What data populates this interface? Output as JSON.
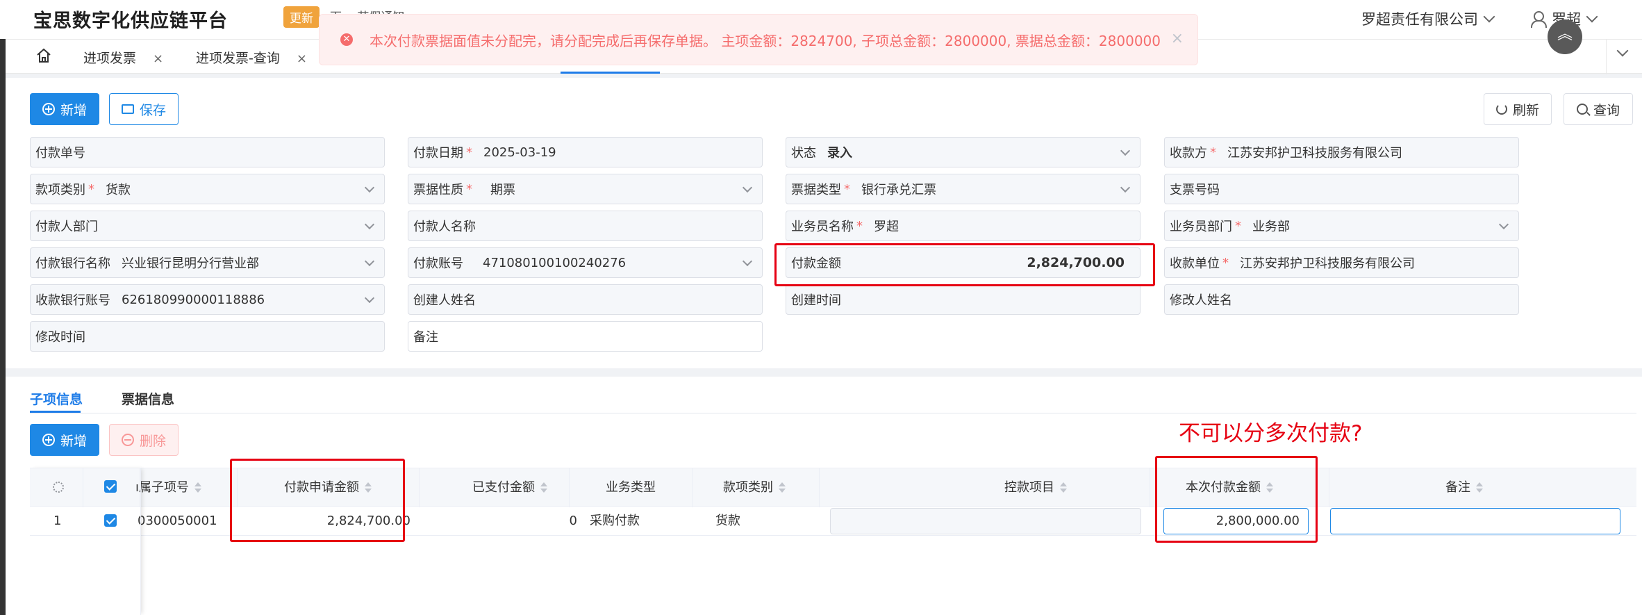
{
  "header": {
    "app_title": "宝思数字化供应链平台",
    "update_badge": "更新",
    "notice_text": "下一 节假通知",
    "company": "罗超责任有限公司",
    "user": "罗超"
  },
  "tabs": [
    {
      "label": "进项发票",
      "close": "×"
    },
    {
      "label": "进项发票-查询",
      "close": "×"
    }
  ],
  "alert": {
    "message": "本次付款票据面值未分配完，请分配完成后再保存单据。 主项金额：2824700, 子项总金额：2800000, 票据总金额：2800000",
    "close": "×"
  },
  "toolbar": {
    "add_label": "新增",
    "save_label": "保存",
    "refresh_label": "刷新",
    "query_label": "查询"
  },
  "form": {
    "pay_no_label": "付款单号",
    "pay_date_label": "付款日期",
    "pay_date_value": "2025-03-19",
    "status_label": "状态",
    "status_value": "录入",
    "payee_label": "收款方",
    "payee_value": "江苏安邦护卫科技服务有限公司",
    "fund_type_label": "款项类别",
    "fund_type_value": "货款",
    "bill_nature_label": "票据性质",
    "bill_nature_value": "期票",
    "bill_type_label": "票据类型",
    "bill_type_value": "银行承兑汇票",
    "check_no_label": "支票号码",
    "payer_dept_label": "付款人部门",
    "payer_name_label": "付款人名称",
    "salesman_label": "业务员名称",
    "salesman_value": "罗超",
    "salesman_dept_label": "业务员部门",
    "salesman_dept_value": "业务部",
    "pay_bank_label": "付款银行名称",
    "pay_bank_value": "兴业银行昆明分行营业部",
    "pay_account_label": "付款账号",
    "pay_account_value": "471080100100240276",
    "pay_amount_label": "付款金额",
    "pay_amount_value": "2,824,700.00",
    "receiver_unit_label": "收款单位",
    "receiver_unit_value": "江苏安邦护卫科技服务有限公司",
    "recv_account_label": "收款银行账号",
    "recv_account_value": "626180990000118886",
    "creator_label": "创建人姓名",
    "create_time_label": "创建时间",
    "modifier_label": "修改人姓名",
    "modify_time_label": "修改时间",
    "remark_label": "备注"
  },
  "subtabs": {
    "items_label": "子项信息",
    "bills_label": "票据信息"
  },
  "subtoolbar": {
    "add_label": "新增",
    "delete_label": "删除"
  },
  "annotation": "不可以分多次付款?",
  "table": {
    "headers": {
      "item_no": "ı属子项号",
      "apply_amount": "付款申请金额",
      "paid_amount": "已支付金额",
      "biz_type": "业务类型",
      "fund_type": "款项类别",
      "control_item": "控款项目",
      "this_amount": "本次付款金额",
      "remark": "备注"
    },
    "rows": [
      {
        "index": "1",
        "item_no": "0300050001",
        "apply_amount": "2,824,700.00",
        "paid_amount": "0",
        "biz_type": "采购付款",
        "fund_type": "货款",
        "control_item": "",
        "this_amount": "2,800,000.00",
        "remark": ""
      }
    ]
  },
  "colors": {
    "primary": "#1e88e5",
    "error": "#f56c6c",
    "annotation_red": "#e60012",
    "badge": "#f0a33c"
  }
}
